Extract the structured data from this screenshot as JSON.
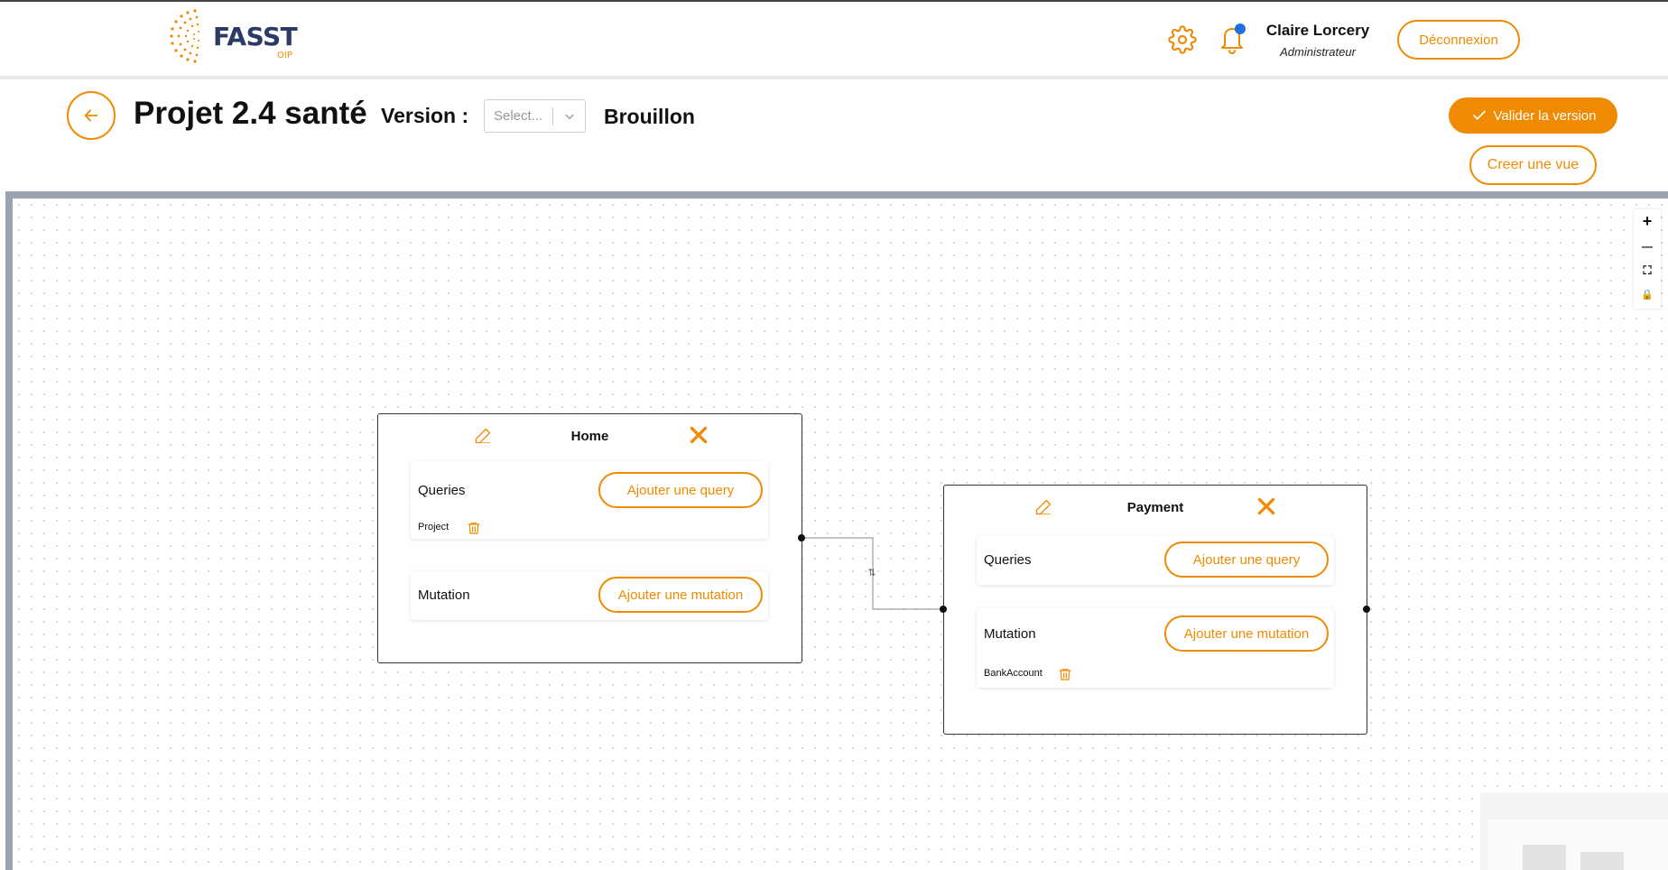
{
  "header": {
    "logo_text": "FASST",
    "logo_sub": "OIP",
    "user_name": "Claire Lorcery",
    "user_role": "Administrateur",
    "logout_label": "Déconnexion",
    "icons": [
      "gear-icon",
      "bell-icon",
      "notification-dot"
    ]
  },
  "project": {
    "title": "Projet 2.4 santé",
    "version_label": "Version :",
    "version_placeholder": "Select...",
    "status": "Brouillon",
    "validate_label": "Valider la version",
    "create_view_label": "Creer une vue"
  },
  "canvas": {
    "zoom_controls": [
      "+",
      "—",
      "⛶",
      "🔒"
    ],
    "nodes": [
      {
        "title": "Home",
        "queries_label": "Queries",
        "add_query_label": "Ajouter une query",
        "query_items": [
          "Project"
        ],
        "mutation_label": "Mutation",
        "add_mutation_label": "Ajouter une mutation",
        "mutation_items": []
      },
      {
        "title": "Payment",
        "queries_label": "Queries",
        "add_query_label": "Ajouter une query",
        "query_items": [],
        "mutation_label": "Mutation",
        "add_mutation_label": "Ajouter une mutation",
        "mutation_items": [
          "BankAccount"
        ]
      }
    ],
    "edge_icon": "⇅"
  },
  "colors": {
    "accent": "#f08a00",
    "brand": "#2b3a67",
    "canvas_border": "#9aa4ae",
    "notification": "#1e6fe0"
  }
}
